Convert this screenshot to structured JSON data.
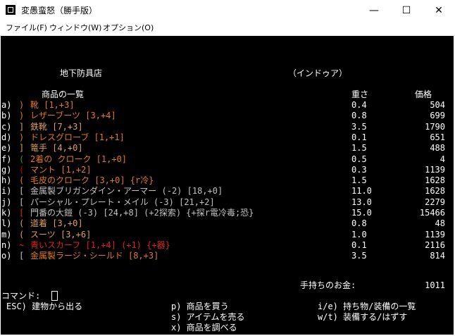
{
  "window": {
    "title": "変愚蛮怒（勝手版）",
    "minimize": "—",
    "maximize": "☐",
    "close": "✕"
  },
  "menu": {
    "items": [
      "ファイル(F)",
      "ウィンドウ(W)",
      "オプション(O)"
    ]
  },
  "shop": {
    "name": "地下防具店",
    "owner": "（インドゥア）",
    "list_header": "商品の一覧",
    "weight_header": "重さ",
    "price_header": "価格",
    "items": [
      {
        "letter": "a) ",
        "symbol": ")",
        "name": "靴 [1,+3]",
        "weight": "0.4",
        "price": "504",
        "color": "#e07a1f",
        "symbol_color": "#e07a1f"
      },
      {
        "letter": "b) ",
        "symbol": ")",
        "name": "レザーブーツ [3,+4]",
        "weight": "0.8",
        "price": "699",
        "color": "#e07a1f",
        "symbol_color": "#e07a1f"
      },
      {
        "letter": "c) ",
        "symbol": "]",
        "name": "鉄靴 [7,+3]",
        "weight": "3.5",
        "price": "1790",
        "color": "#d9a060",
        "symbol_color": "#d9a060"
      },
      {
        "letter": "d) ",
        "symbol": ")",
        "name": "ドレスグローブ [1,+1]",
        "weight": "0.1",
        "price": "651",
        "color": "#e07a1f",
        "symbol_color": "#e07a1f"
      },
      {
        "letter": "e) ",
        "symbol": "]",
        "name": "篭手 [4,+0]",
        "weight": "1.5",
        "price": "488",
        "color": "#d9a060",
        "symbol_color": "#d9a060"
      },
      {
        "letter": "f) ",
        "symbol": "(",
        "name": "2着の クローク [1,+0]",
        "weight": "0.5",
        "price": "4",
        "color": "#e07a1f",
        "symbol_color": "#20a020"
      },
      {
        "letter": "g) ",
        "symbol": "(",
        "name": "マント [1,+2]",
        "weight": "0.3",
        "price": "1139",
        "color": "#e07a1f",
        "symbol_color": "#c00000"
      },
      {
        "letter": "h) ",
        "symbol": "(",
        "name": "毛皮のクローク [3,+0] {r冷}",
        "weight": "1.5",
        "price": "1628",
        "color": "#e07a1f",
        "symbol_color": "#e07a1f"
      },
      {
        "letter": "i) ",
        "symbol": "[",
        "name": "金属製ブリガンダイン・アーマー (-2) [18,+0]",
        "weight": "11.0",
        "price": "1628",
        "color": "#c0c0c0",
        "symbol_color": "#c0c0c0"
      },
      {
        "letter": "j) ",
        "symbol": "[",
        "name": "パーシャル・プレート・メイル (-3) [21,+2]",
        "weight": "13.0",
        "price": "2279",
        "color": "#c0c0c0",
        "symbol_color": "#c0c0c0"
      },
      {
        "letter": "k) ",
        "symbol": "[",
        "name": "門番の大鎧 (-3) [24,+8] (+2探索) {+探r電冷毒;恐}",
        "weight": "15.0",
        "price": "15466",
        "color": "#c0c0c0",
        "symbol_color": "#e02020"
      },
      {
        "letter": "l) ",
        "symbol": "(",
        "name": "道着 [3,+0]",
        "weight": "0.8",
        "price": "48",
        "color": "#d9a060",
        "symbol_color": "#d9a060"
      },
      {
        "letter": "m) ",
        "symbol": "(",
        "name": "スーツ [3,+6]",
        "weight": "1.0",
        "price": "1139",
        "color": "#d9a060",
        "symbol_color": "#d9a060"
      },
      {
        "letter": "n) ",
        "symbol": "~",
        "name": "青いスカーフ [1,+4] (+1) {+器}",
        "weight": "0.1",
        "price": "2116",
        "color": "#e02020",
        "symbol_color": "#e02020"
      },
      {
        "letter": "o) ",
        "symbol": "[",
        "name": "金属製ラージ・シールド [8,+3]",
        "weight": "3.5",
        "price": "814",
        "color": "#e07a1f",
        "symbol_color": "#c0c0c0"
      }
    ]
  },
  "gold": {
    "label": "手持ちのお金:",
    "value": "1011"
  },
  "command": {
    "prompt": "コマンド:"
  },
  "commands": {
    "esc": "ESC) 建物から出る",
    "purchase": "p) 商品を買う",
    "sell": "s) アイテムを売る",
    "examine": "x) 商品を調べる",
    "inventory": "i/e) 持ち物/装備の一覧",
    "wear": "w/t) 装備する/はずす"
  }
}
